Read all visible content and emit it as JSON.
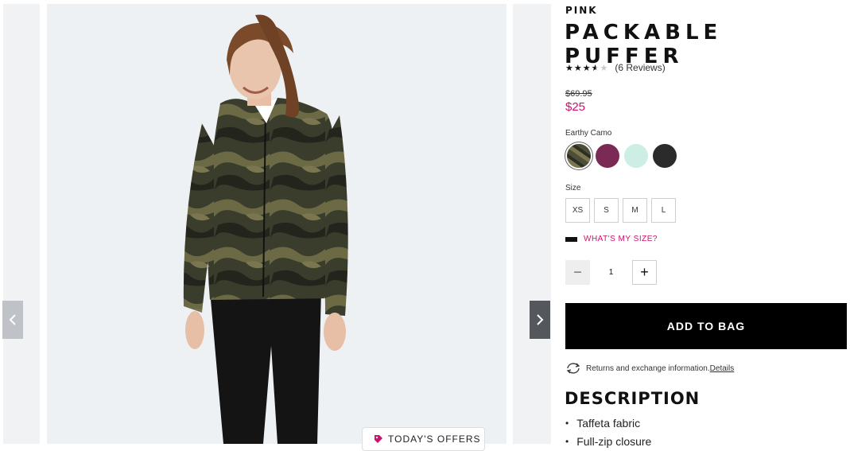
{
  "product": {
    "brand": "PINK",
    "title": "PACKABLE PUFFER",
    "rating": {
      "value": 3.5,
      "max": 5,
      "reviews_text": "(6 Reviews)"
    },
    "price_original": "$69.95",
    "price_sale": "$25",
    "color_label": "Earthy Camo",
    "swatches": [
      {
        "name": "Earthy Camo",
        "color": "#5a5a44",
        "selected": true
      },
      {
        "name": "Berry",
        "color": "#7b2a55",
        "selected": false
      },
      {
        "name": "Mint",
        "color": "#cdeee4",
        "selected": false
      },
      {
        "name": "Black",
        "color": "#2b2b2b",
        "selected": false
      }
    ],
    "size_label": "Size",
    "sizes": [
      "XS",
      "S",
      "M",
      "L"
    ],
    "whats_my_size": "WHAT'S MY SIZE?",
    "quantity": "1",
    "add_to_bag": "ADD TO BAG",
    "returns_text": "Returns and exchange information.",
    "returns_link": "Details",
    "description_title": "DESCRIPTION",
    "description_items": [
      "Taffeta fabric",
      "Full-zip closure"
    ]
  },
  "gallery": {
    "offers_label": "TODAY'S OFFERS"
  },
  "colors": {
    "accent": "#d0106d",
    "button": "#000000"
  }
}
